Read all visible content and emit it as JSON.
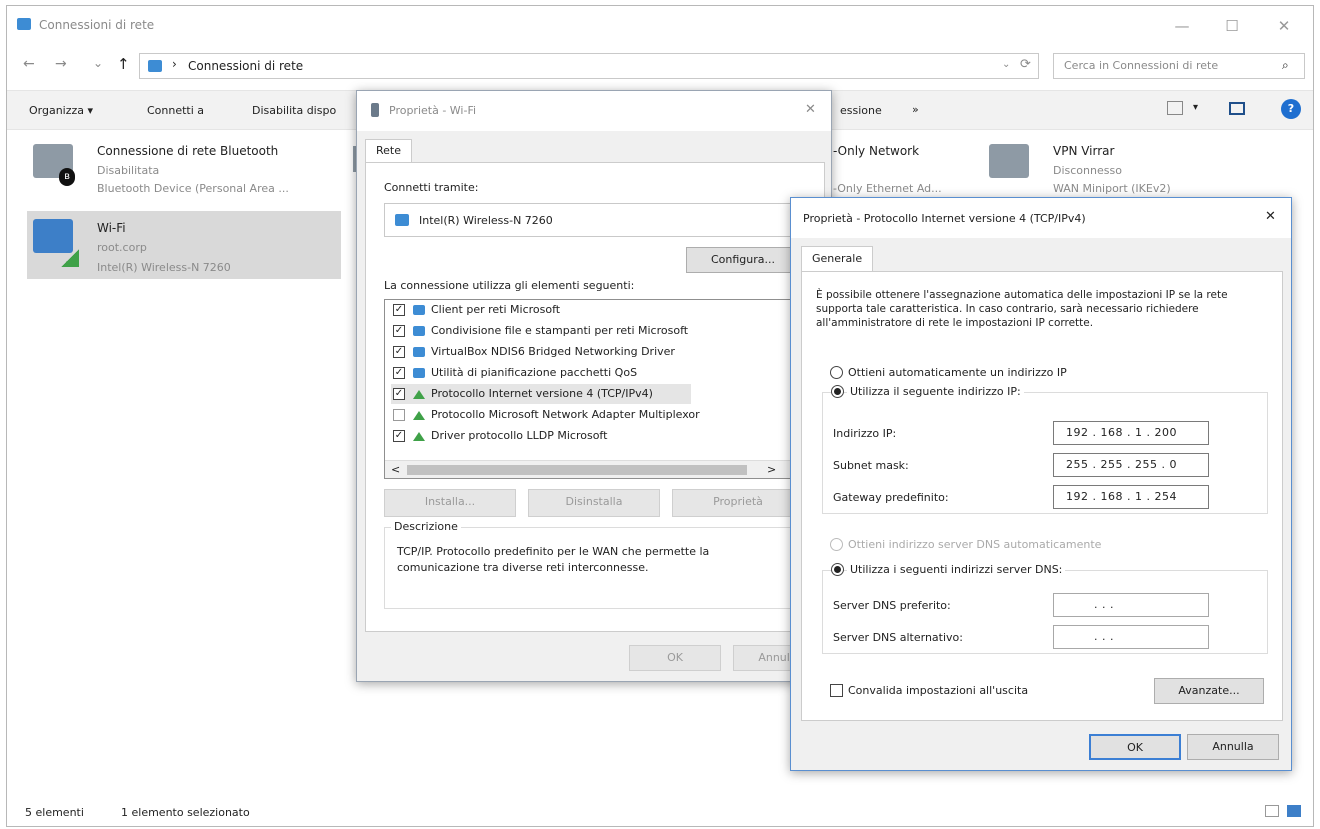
{
  "explorer": {
    "title": "Connessioni di rete",
    "window_controls": {
      "minimize": "—",
      "maximize": "☐",
      "close": "✕"
    },
    "nav": {
      "back": "←",
      "forward": "→",
      "recent": "⌄",
      "up": "↑",
      "separator": "›"
    },
    "address": "Connessioni di rete",
    "refresh": "⟳",
    "search_placeholder": "Cerca in Connessioni di rete",
    "commands": {
      "organize": "Organizza ▾",
      "connect": "Connetti a",
      "disable": "Disabilita dispo",
      "more": "essione",
      "more_arrow": "»"
    },
    "connections": [
      {
        "name": "Connessione di rete Bluetooth",
        "status": "Disabilitata",
        "device": "Bluetooth Device (Personal Area ..."
      },
      {
        "name": "Wi-Fi",
        "status": "root.corp",
        "device": "Intel(R) Wireless-N 7260"
      },
      {
        "name": "-Only Network",
        "device": "-Only Ethernet Ad..."
      },
      {
        "name": "VPN Virrar",
        "status": "Disconnesso",
        "device": "WAN Miniport (IKEv2)"
      }
    ],
    "status_bar": {
      "count": "5 elementi",
      "selected": "1 elemento selezionato"
    }
  },
  "wifi_dialog": {
    "title": "Proprietà - Wi-Fi",
    "close": "✕",
    "tab": "Rete",
    "connect_using_label": "Connetti tramite:",
    "adapter": "Intel(R) Wireless-N 7260",
    "configure": "Configura...",
    "items_label": "La connessione utilizza gli elementi seguenti:",
    "items": [
      {
        "label": "Client per reti Microsoft",
        "checked": true
      },
      {
        "label": "Condivisione file e stampanti per reti Microsoft",
        "checked": true
      },
      {
        "label": "VirtualBox NDIS6 Bridged Networking Driver",
        "checked": true
      },
      {
        "label": "Utilità di pianificazione pacchetti QoS",
        "checked": true
      },
      {
        "label": "Protocollo Internet versione 4 (TCP/IPv4)",
        "checked": true
      },
      {
        "label": "Protocollo Microsoft Network Adapter Multiplexor",
        "checked": false
      },
      {
        "label": "Driver protocollo LLDP Microsoft",
        "checked": true
      }
    ],
    "scroll_left": "<",
    "scroll_right": ">",
    "install": "Installa...",
    "uninstall": "Disinstalla",
    "properties": "Proprietà",
    "description_label": "Descrizione",
    "description": "TCP/IP. Protocollo predefinito per le WAN che permette la comunicazione tra diverse reti interconnesse.",
    "ok": "OK",
    "cancel": "Annulla"
  },
  "ipv4_dialog": {
    "title": "Proprietà - Protocollo Internet versione 4 (TCP/IPv4)",
    "close": "✕",
    "tab": "Generale",
    "intro": "È possibile ottenere l'assegnazione automatica delle impostazioni IP se la rete supporta tale caratteristica. In caso contrario, sarà necessario richiedere all'amministratore di rete le impostazioni IP corrette.",
    "auto_ip": "Ottieni automaticamente un indirizzo IP",
    "manual_ip": "Utilizza il seguente indirizzo IP:",
    "ip_label": "Indirizzo IP:",
    "ip_value": "192 . 168 .  1  . 200",
    "mask_label": "Subnet mask:",
    "mask_value": "255 . 255 . 255 .  0",
    "gateway_label": "Gateway predefinito:",
    "gateway_value": "192 . 168 .  1  . 254",
    "auto_dns": "Ottieni indirizzo server DNS automaticamente",
    "manual_dns": "Utilizza i seguenti indirizzi server DNS:",
    "dns_pref_label": "Server DNS preferito:",
    "dns_pref_value": ".     .     .",
    "dns_alt_label": "Server DNS alternativo:",
    "dns_alt_value": ".     .     .",
    "validate": "Convalida impostazioni all'uscita",
    "advanced": "Avanzate...",
    "ok": "OK",
    "cancel": "Annulla"
  }
}
